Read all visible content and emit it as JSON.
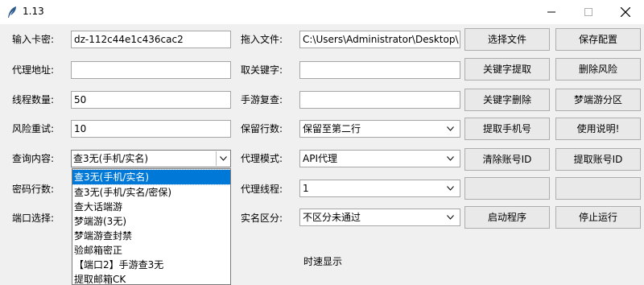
{
  "window": {
    "title": "1.13",
    "icon": "feather-icon",
    "controls": [
      "minimize",
      "maximize",
      "close"
    ]
  },
  "left": {
    "card_key": {
      "label": "输入卡密:",
      "value": "dz-112c44e1c436cac2"
    },
    "proxy_addr": {
      "label": "代理地址:",
      "value": ""
    },
    "threads": {
      "label": "线程数量:",
      "value": "50"
    },
    "retry": {
      "label": "风险重试:",
      "value": "10"
    },
    "query": {
      "label": "查询内容:",
      "value": "查3无(手机/实名)"
    },
    "pwd_rows": {
      "label": "密码行数:"
    },
    "port": {
      "label": "端口选择:"
    }
  },
  "dropdown_options": [
    "查3无(手机/实名)",
    "查3无(手机/实名/密保)",
    "查大话端游",
    "梦端游(3无)",
    "梦端游查封禁",
    "验邮箱密正",
    "【端口2】手游查3无",
    "提取邮箱CK"
  ],
  "middle": {
    "drag_file": {
      "label": "拖入文件:",
      "value": "C:\\Users\\Administrator\\Desktop\\"
    },
    "keyword": {
      "label": "取关键字:",
      "value": ""
    },
    "mobile_recheck": {
      "label": "手游复查:",
      "value": ""
    },
    "keep_rows": {
      "label": "保留行数:",
      "value": "保留至第二行"
    },
    "proxy_mode": {
      "label": "代理模式:",
      "value": "API代理"
    },
    "proxy_threads": {
      "label": "代理线程:",
      "value": "1"
    },
    "realname": {
      "label": "实名区分:",
      "value": "不区分未通过"
    }
  },
  "buttons": {
    "select_file": "选择文件",
    "save_config": "保存配置",
    "keyword_extract": "关键字提取",
    "delete_risk": "删除风险",
    "keyword_delete": "关键字删除",
    "dream_zone": "梦端游分区",
    "extract_phone": "提取手机号",
    "usage": "使用说明!",
    "clear_id": "清除账号ID",
    "extract_id": "提取账号ID",
    "start": "启动程序",
    "stop": "停止运行"
  },
  "status": {
    "speed": "时速显示"
  }
}
